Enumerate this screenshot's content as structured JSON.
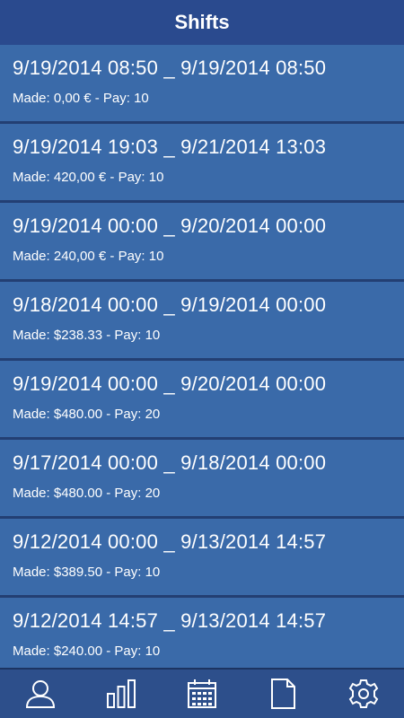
{
  "header": {
    "title": "Shifts"
  },
  "shifts": [
    {
      "range": "9/19/2014 08:50 _ 9/19/2014 08:50",
      "summary": "Made: 0,00 € - Pay: 10"
    },
    {
      "range": "9/19/2014 19:03 _ 9/21/2014 13:03",
      "summary": "Made: 420,00 € - Pay: 10"
    },
    {
      "range": "9/19/2014 00:00 _ 9/20/2014 00:00",
      "summary": "Made: 240,00 € - Pay: 10"
    },
    {
      "range": "9/18/2014 00:00 _ 9/19/2014 00:00",
      "summary": "Made: $238.33 - Pay: 10"
    },
    {
      "range": "9/19/2014 00:00 _ 9/20/2014 00:00",
      "summary": "Made: $480.00 - Pay: 20"
    },
    {
      "range": "9/17/2014 00:00 _ 9/18/2014 00:00",
      "summary": "Made: $480.00 - Pay: 20"
    },
    {
      "range": "9/12/2014 00:00 _ 9/13/2014 14:57",
      "summary": "Made: $389.50 - Pay: 10"
    },
    {
      "range": "9/12/2014 14:57 _ 9/13/2014 14:57",
      "summary": "Made: $240.00 - Pay: 10"
    }
  ],
  "bottom_nav": [
    {
      "icon": "user-icon"
    },
    {
      "icon": "bar-chart-icon"
    },
    {
      "icon": "calendar-icon"
    },
    {
      "icon": "document-icon"
    },
    {
      "icon": "gear-icon"
    }
  ],
  "colors": {
    "header_bg": "#2a4a8e",
    "row_bg": "#3a6aa9",
    "row_divider": "#233f73",
    "nav_bg": "#2d4f8b",
    "text": "#ffffff"
  }
}
